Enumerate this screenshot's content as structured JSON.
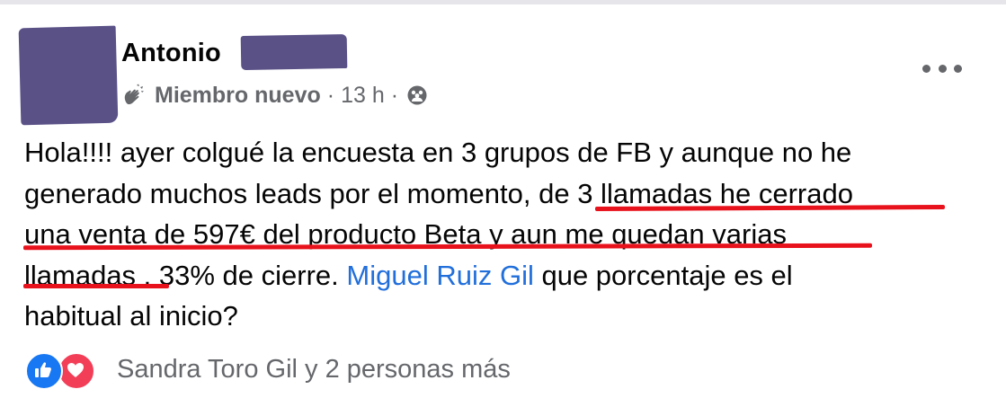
{
  "post": {
    "author": "Antonio",
    "badge": "Miembro nuevo",
    "separator_1": "·",
    "time": "13 h",
    "separator_2": "·",
    "audience_icon": "group-icon",
    "more_icon": "more-options-icon",
    "body_lines": [
      "Hola!!!! ayer colgué la encuesta en 3 grupos de FB y aunque no he",
      "generado muchos leads por el momento, de 3 llamadas he cerrado",
      "una venta de 597€ del producto Beta y aun me quedan varias",
      "llamadas .  33% de cierre. "
    ],
    "mention": "Miguel Ruiz Gil",
    "line4_tail": " que porcentaje es el",
    "line5": "habitual al inicio?",
    "highlight_color": "#e8121c",
    "mention_color": "#216fdb"
  },
  "reactions": {
    "icons": [
      "like-icon",
      "love-icon"
    ],
    "text": "Sandra Toro Gil y 2 personas más"
  }
}
